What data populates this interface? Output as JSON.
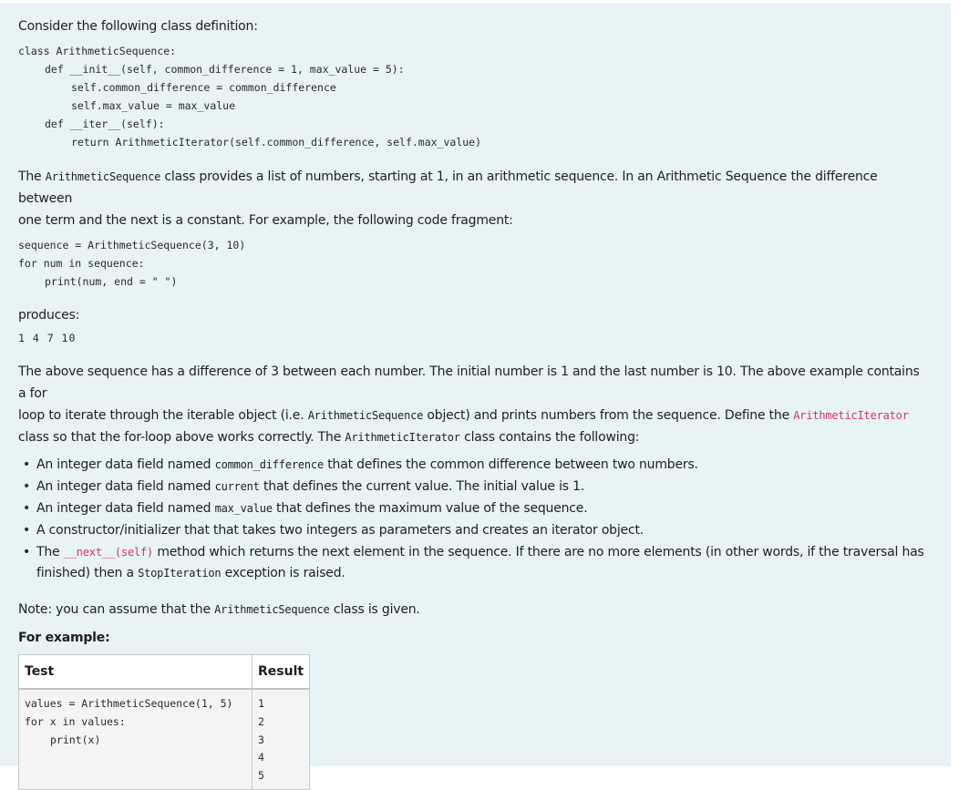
{
  "intro": "Consider the following class definition:",
  "class_code": [
    "class ArithmeticSequence:",
    "def __init__(self, common_difference = 1, max_value = 5):",
    "self.common_difference = common_difference",
    "self.max_value = max_value",
    "def __iter__(self):",
    "return ArithmeticIterator(self.common_difference, self.max_value)"
  ],
  "para1": {
    "before": "The ",
    "cls": "ArithmeticSequence",
    "after_line1": " class provides a list of numbers, starting at 1, in an arithmetic sequence. In an Arithmetic Sequence the difference between",
    "line2": "one term and the next is a constant. For example, the following code fragment:"
  },
  "example_code": [
    "sequence = ArithmeticSequence(3, 10)",
    "for num in sequence:",
    "print(num, end = \" \")"
  ],
  "produces_label": "produces:",
  "produces_output": "1 4 7 10",
  "para2": {
    "line1": "The above sequence has a difference of 3 between each number. The initial number is 1 and the last number is 10. The above example contains a for",
    "line2_a": "loop to iterate through the iterable object (i.e. ",
    "line2_cls": "ArithmeticSequence",
    "line2_b": " object) and prints numbers from the sequence. Define the ",
    "line2_pink": "ArithmeticIterator",
    "line3_a": "class so that the for-loop above works correctly. The ",
    "line3_cls": "ArithmeticIterator",
    "line3_b": " class contains the following:"
  },
  "requirements": [
    {
      "a": "An integer data field named ",
      "code": "common_difference",
      "b": " that defines the common difference between two numbers."
    },
    {
      "a": "An integer data field named ",
      "code": "current",
      "b": " that defines the current value. The initial value is 1."
    },
    {
      "a": "An integer data field named ",
      "code": "max_value",
      "b": " that defines the maximum value of the sequence."
    },
    {
      "a": "A constructor/initializer that that takes two integers as parameters and creates an iterator object.",
      "code": "",
      "b": ""
    }
  ],
  "req_next": {
    "a": "The ",
    "pink": "__next__(self)",
    "b": " method which returns the next element in the sequence. If there are no more elements (in other words, if the traversal has",
    "line2_a": "finished) then a ",
    "line2_code": "StopIteration",
    "line2_b": " exception is raised."
  },
  "note": {
    "a": "Note: you can assume that the ",
    "code": "ArithmeticSequence",
    "b": " class is given."
  },
  "for_example": "For example:",
  "table": {
    "headers": [
      "Test",
      "Result"
    ],
    "test_code": [
      "values = ArithmeticSequence(1, 5)",
      "for x in values:",
      "print(x)"
    ],
    "result_lines": [
      "1",
      "2",
      "3",
      "4",
      "5"
    ]
  }
}
